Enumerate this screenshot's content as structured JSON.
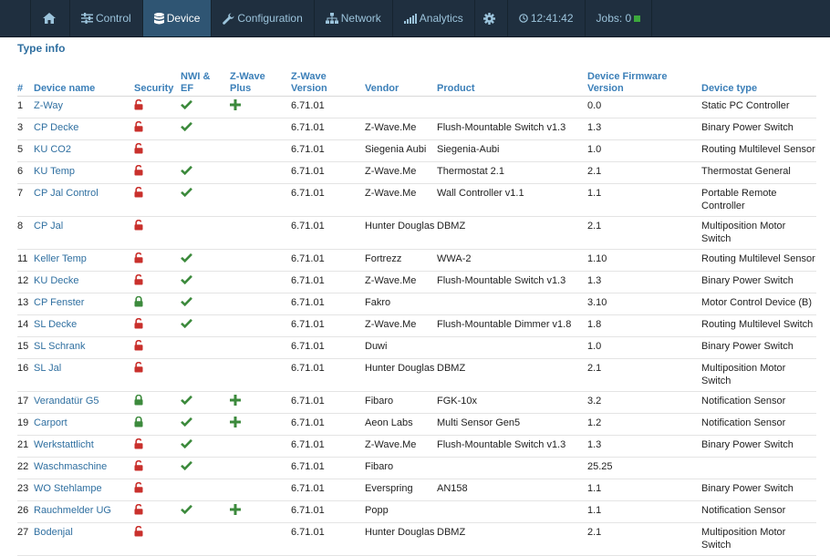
{
  "nav": {
    "home_icon": "home-icon",
    "items": [
      {
        "label": "Control",
        "icon": "sliders-icon"
      },
      {
        "label": "Device",
        "icon": "database-icon"
      },
      {
        "label": "Configuration",
        "icon": "wrench-icon"
      },
      {
        "label": "Network",
        "icon": "network-icon"
      },
      {
        "label": "Analytics",
        "icon": "bar-chart-icon"
      }
    ],
    "gear_icon": "gear-icon",
    "time": "12:41:42",
    "jobs": "Jobs: 0"
  },
  "page": {
    "section_title": "Type info"
  },
  "table": {
    "headers": {
      "num": "#",
      "name": "Device name",
      "security": "Security",
      "nwi_line1": "NWI &",
      "nwi_line2": "EF",
      "zplus_line1": "Z-Wave",
      "zplus_line2": "Plus",
      "zver_line1": "Z-Wave",
      "zver_line2": "Version",
      "vendor": "Vendor",
      "product": "Product",
      "fw_line1": "Device Firmware",
      "fw_line2": "Version",
      "type": "Device type"
    },
    "colors": {
      "lock_open": "#c9302c",
      "lock_closed": "#3c8a3c",
      "check": "#3c8a3c",
      "plus": "#3c8a3c",
      "link": "#2f6fa0"
    },
    "rows": [
      {
        "num": "1",
        "name": "Z-Way",
        "security": "open",
        "nwi": true,
        "plus": true,
        "version": "6.71.01",
        "vendor": "",
        "product": "",
        "firmware": "0.0",
        "type": "Static PC Controller"
      },
      {
        "num": "3",
        "name": "CP Decke",
        "security": "open",
        "nwi": true,
        "plus": false,
        "version": "6.71.01",
        "vendor": "Z-Wave.Me",
        "product": "Flush-Mountable Switch v1.3",
        "firmware": "1.3",
        "type": "Binary Power Switch"
      },
      {
        "num": "5",
        "name": "KU CO2",
        "security": "open",
        "nwi": false,
        "plus": false,
        "version": "6.71.01",
        "vendor": "Siegenia Aubi",
        "product": "Siegenia-Aubi",
        "firmware": "1.0",
        "type": "Routing Multilevel Sensor"
      },
      {
        "num": "6",
        "name": "KU Temp",
        "security": "open",
        "nwi": true,
        "plus": false,
        "version": "6.71.01",
        "vendor": "Z-Wave.Me",
        "product": "Thermostat 2.1",
        "firmware": "2.1",
        "type": "Thermostat General"
      },
      {
        "num": "7",
        "name": "CP Jal Control",
        "security": "open",
        "nwi": true,
        "plus": false,
        "version": "6.71.01",
        "vendor": "Z-Wave.Me",
        "product": "Wall Controller v1.1",
        "firmware": "1.1",
        "type": "Portable Remote Controller"
      },
      {
        "num": "8",
        "name": "CP Jal",
        "security": "open",
        "nwi": false,
        "plus": false,
        "version": "6.71.01",
        "vendor": "Hunter Douglas",
        "product": "DBMZ",
        "firmware": "2.1",
        "type": "Multiposition Motor Switch"
      },
      {
        "num": "11",
        "name": "Keller Temp",
        "security": "open",
        "nwi": true,
        "plus": false,
        "version": "6.71.01",
        "vendor": "Fortrezz",
        "product": "WWA-2",
        "firmware": "1.10",
        "type": "Routing Multilevel Sensor"
      },
      {
        "num": "12",
        "name": "KU Decke",
        "security": "open",
        "nwi": true,
        "plus": false,
        "version": "6.71.01",
        "vendor": "Z-Wave.Me",
        "product": "Flush-Mountable Switch v1.3",
        "firmware": "1.3",
        "type": "Binary Power Switch"
      },
      {
        "num": "13",
        "name": "CP Fenster",
        "security": "closed",
        "nwi": true,
        "plus": false,
        "version": "6.71.01",
        "vendor": "Fakro",
        "product": "",
        "firmware": "3.10",
        "type": "Motor Control Device (B)"
      },
      {
        "num": "14",
        "name": "SL Decke",
        "security": "open",
        "nwi": true,
        "plus": false,
        "version": "6.71.01",
        "vendor": "Z-Wave.Me",
        "product": "Flush-Mountable Dimmer v1.8",
        "firmware": "1.8",
        "type": "Routing Multilevel Switch"
      },
      {
        "num": "15",
        "name": "SL Schrank",
        "security": "open",
        "nwi": false,
        "plus": false,
        "version": "6.71.01",
        "vendor": "Duwi",
        "product": "",
        "firmware": "1.0",
        "type": "Binary Power Switch"
      },
      {
        "num": "16",
        "name": "SL Jal",
        "security": "open",
        "nwi": false,
        "plus": false,
        "version": "6.71.01",
        "vendor": "Hunter Douglas",
        "product": "DBMZ",
        "firmware": "2.1",
        "type": "Multiposition Motor Switch"
      },
      {
        "num": "17",
        "name": "Verandatür G5",
        "security": "closed",
        "nwi": true,
        "plus": true,
        "version": "6.71.01",
        "vendor": "Fibaro",
        "product": "FGK-10x",
        "firmware": "3.2",
        "type": "Notification Sensor"
      },
      {
        "num": "19",
        "name": "Carport",
        "security": "closed",
        "nwi": true,
        "plus": true,
        "version": "6.71.01",
        "vendor": "Aeon Labs",
        "product": "Multi Sensor Gen5",
        "firmware": "1.2",
        "type": "Notification Sensor"
      },
      {
        "num": "21",
        "name": "Werkstattlicht",
        "security": "open",
        "nwi": true,
        "plus": false,
        "version": "6.71.01",
        "vendor": "Z-Wave.Me",
        "product": "Flush-Mountable Switch v1.3",
        "firmware": "1.3",
        "type": "Binary Power Switch"
      },
      {
        "num": "22",
        "name": "Waschmaschine",
        "security": "open",
        "nwi": true,
        "plus": false,
        "version": "6.71.01",
        "vendor": "Fibaro",
        "product": "",
        "firmware": "25.25",
        "type": ""
      },
      {
        "num": "23",
        "name": "WO Stehlampe",
        "security": "open",
        "nwi": false,
        "plus": false,
        "version": "6.71.01",
        "vendor": "Everspring",
        "product": "AN158",
        "firmware": "1.1",
        "type": "Binary Power Switch"
      },
      {
        "num": "26",
        "name": "Rauchmelder UG",
        "security": "open",
        "nwi": true,
        "plus": true,
        "version": "6.71.01",
        "vendor": "Popp",
        "product": "",
        "firmware": "1.1",
        "type": "Notification Sensor"
      },
      {
        "num": "27",
        "name": "Bodenjal",
        "security": "open",
        "nwi": false,
        "plus": false,
        "version": "6.71.01",
        "vendor": "Hunter Douglas",
        "product": "DBMZ",
        "firmware": "2.1",
        "type": "Multiposition Motor Switch"
      }
    ]
  }
}
